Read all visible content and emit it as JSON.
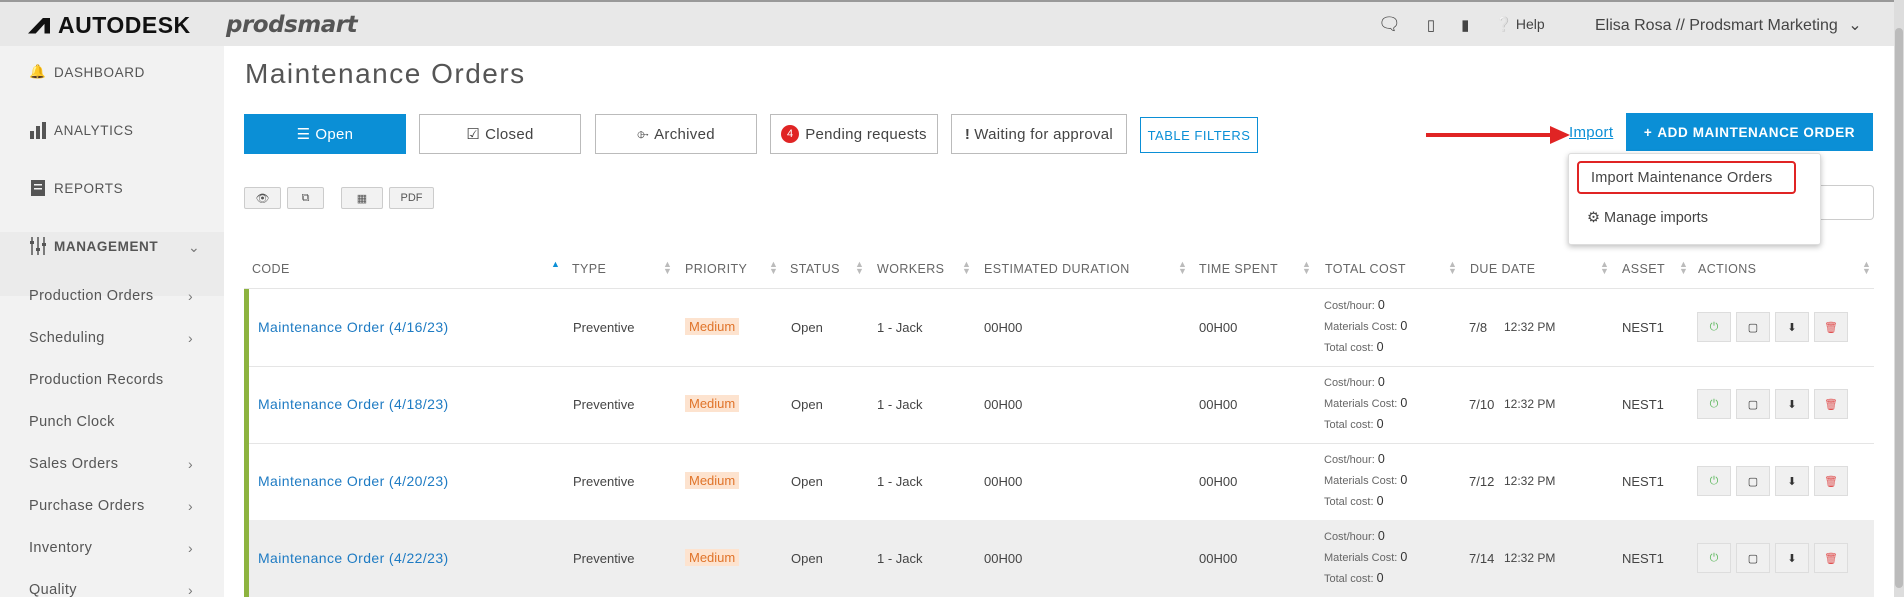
{
  "topbar": {
    "brand": "AUTODESK",
    "product": "prodsmart",
    "help": "Help",
    "user": "Elisa Rosa // Prodsmart Marketing"
  },
  "sidebar": {
    "top_items": [
      {
        "label": "DASHBOARD",
        "icon": "bell-icon"
      },
      {
        "label": "ANALYTICS",
        "icon": "bar-chart-icon"
      },
      {
        "label": "REPORTS",
        "icon": "document-icon"
      },
      {
        "label": "MANAGEMENT",
        "icon": "sliders-icon"
      }
    ],
    "sub_items": [
      {
        "label": "Production Orders",
        "chevron": true
      },
      {
        "label": "Scheduling",
        "chevron": true
      },
      {
        "label": "Production Records",
        "chevron": false
      },
      {
        "label": "Punch Clock",
        "chevron": false
      },
      {
        "label": "Sales Orders",
        "chevron": true
      },
      {
        "label": "Purchase Orders",
        "chevron": true
      },
      {
        "label": "Inventory",
        "chevron": true
      },
      {
        "label": "Quality",
        "chevron": true
      }
    ]
  },
  "page": {
    "title": "Maintenance Orders",
    "tabs": {
      "open": "Open",
      "closed": "Closed",
      "archived": "Archived",
      "pending": "Pending requests",
      "pending_count": "4",
      "waiting": "Waiting for approval"
    },
    "table_filters": "TABLE FILTERS",
    "import_link": "Import",
    "add_button": "ADD MAINTENANCE ORDER",
    "dropdown": {
      "import_orders": "Import Maintenance Orders",
      "manage_imports": "Manage imports"
    },
    "tools": {
      "pdf": "PDF"
    }
  },
  "table": {
    "headers": {
      "code": "CODE",
      "type": "TYPE",
      "priority": "PRIORITY",
      "status": "STATUS",
      "workers": "WORKERS",
      "estimated": "ESTIMATED DURATION",
      "time_spent": "TIME SPENT",
      "total_cost": "TOTAL COST",
      "due_date": "DUE DATE",
      "asset": "ASSET",
      "actions": "ACTIONS"
    },
    "cost_labels": {
      "hour": "Cost/hour:",
      "materials": "Materials Cost:",
      "total": "Total cost:"
    },
    "rows": [
      {
        "code": "Maintenance Order (4/16/23)",
        "type": "Preventive",
        "priority": "Medium",
        "status": "Open",
        "workers": "1 - Jack",
        "estimated": "00H00",
        "spent": "00H00",
        "cost_hour": "0",
        "materials": "0",
        "total": "0",
        "date": "7/8",
        "time": "12:32 PM",
        "asset": "NEST1"
      },
      {
        "code": "Maintenance Order (4/18/23)",
        "type": "Preventive",
        "priority": "Medium",
        "status": "Open",
        "workers": "1 - Jack",
        "estimated": "00H00",
        "spent": "00H00",
        "cost_hour": "0",
        "materials": "0",
        "total": "0",
        "date": "7/10",
        "time": "12:32 PM",
        "asset": "NEST1"
      },
      {
        "code": "Maintenance Order (4/20/23)",
        "type": "Preventive",
        "priority": "Medium",
        "status": "Open",
        "workers": "1 - Jack",
        "estimated": "00H00",
        "spent": "00H00",
        "cost_hour": "0",
        "materials": "0",
        "total": "0",
        "date": "7/12",
        "time": "12:32 PM",
        "asset": "NEST1"
      },
      {
        "code": "Maintenance Order (4/22/23)",
        "type": "Preventive",
        "priority": "Medium",
        "status": "Open",
        "workers": "1 - Jack",
        "estimated": "00H00",
        "spent": "00H00",
        "cost_hour": "0",
        "materials": "0",
        "total": "0",
        "date": "7/14",
        "time": "12:32 PM",
        "asset": "NEST1"
      }
    ]
  },
  "colors": {
    "accent": "#0b8fd6",
    "highlight": "#e02424",
    "row_bar": "#8db33f"
  }
}
